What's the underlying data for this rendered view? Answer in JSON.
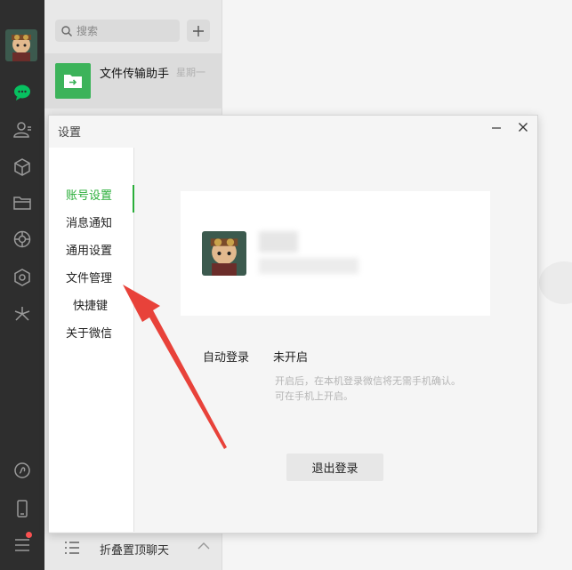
{
  "search": {
    "placeholder": "搜索"
  },
  "chat_list": {
    "items": [
      {
        "name": "文件传输助手",
        "time": "星期一"
      }
    ],
    "fold_label": "折叠置顶聊天"
  },
  "dialog": {
    "title": "设置",
    "sidebar": [
      {
        "label": "账号设置",
        "active": true
      },
      {
        "label": "消息通知"
      },
      {
        "label": "通用设置"
      },
      {
        "label": "文件管理"
      },
      {
        "label": "快捷键"
      },
      {
        "label": "关于微信"
      }
    ],
    "auto_login": {
      "label": "自动登录",
      "value": "未开启",
      "hint_line1": "开启后，在本机登录微信将无需手机确认。",
      "hint_line2": "可在手机上开启。"
    },
    "logout_label": "退出登录"
  },
  "colors": {
    "accent": "#2bae3a",
    "nav_bg": "#2e2e2e",
    "arrow": "#e8423a",
    "badge": "#fa5151"
  },
  "icons": [
    "chat-icon",
    "contacts-icon",
    "cube-icon",
    "folder-icon",
    "moments-icon",
    "mini-program-icon",
    "sparkle-icon",
    "link-icon",
    "phone-icon",
    "menu-icon"
  ]
}
